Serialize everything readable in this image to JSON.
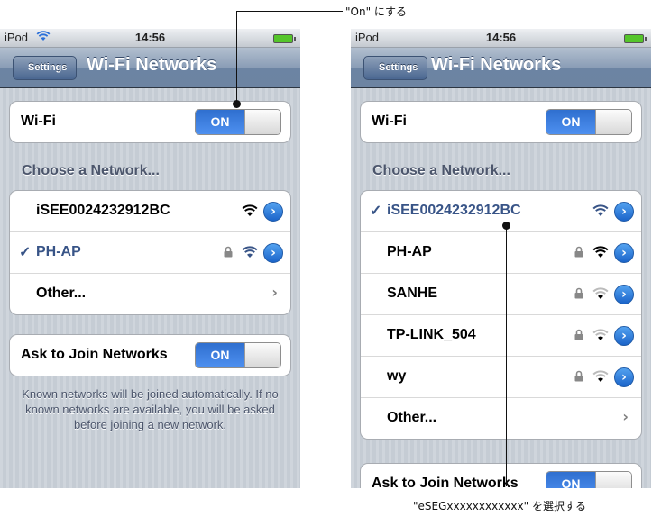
{
  "annotations": {
    "turn_on": "\"On\" にする",
    "select_network": "\"eSEGxxxxxxxxxxxx\" を選択する"
  },
  "left_screen": {
    "status": {
      "carrier": "iPod",
      "time": "14:56"
    },
    "nav": {
      "back": "Settings",
      "title": "Wi-Fi Networks"
    },
    "wifi_label": "Wi-Fi",
    "wifi_toggle": "ON",
    "choose_header": "Choose a Network...",
    "networks": [
      {
        "name": "iSEE0024232912BC"
      },
      {
        "name": "PH-AP"
      }
    ],
    "other_label": "Other...",
    "ask_label": "Ask to Join Networks",
    "ask_toggle": "ON",
    "footer": "Known networks will be joined automatically. If no known networks are available, you will be asked before joining a new network."
  },
  "right_screen": {
    "status": {
      "carrier": "iPod",
      "time": "14:56"
    },
    "nav": {
      "back": "Settings",
      "title": "Wi-Fi Networks"
    },
    "wifi_label": "Wi-Fi",
    "wifi_toggle": "ON",
    "choose_header": "Choose a Network...",
    "networks": [
      {
        "name": "iSEE0024232912BC"
      },
      {
        "name": "PH-AP"
      },
      {
        "name": "SANHE"
      },
      {
        "name": "TP-LINK_504"
      },
      {
        "name": "wy"
      }
    ],
    "other_label": "Other...",
    "ask_label": "Ask to Join Networks",
    "ask_toggle": "ON"
  },
  "icons": {
    "checkmark": "✓",
    "disclosure": "›",
    "chevron": "›"
  },
  "colors": {
    "selected_text": "#385487",
    "toggle_on": "#3b7fe0",
    "navbar": "#6d84a2",
    "background": "#c5ccd4"
  }
}
